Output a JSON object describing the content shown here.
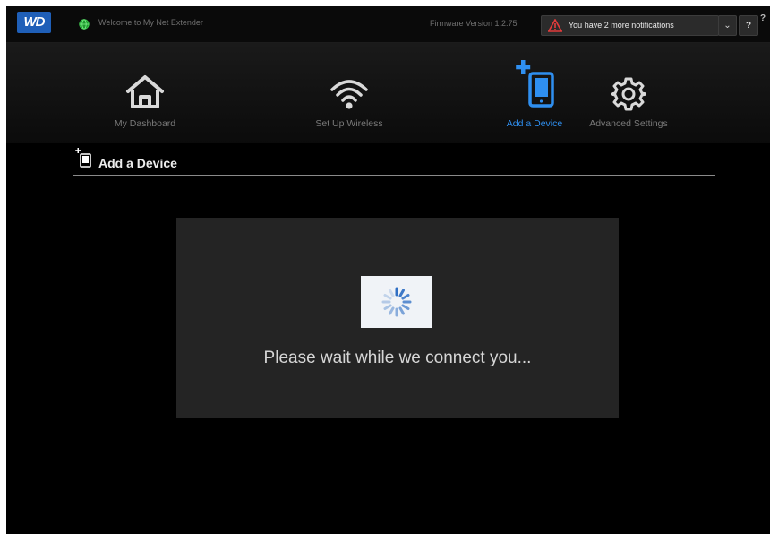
{
  "brand": {
    "logo_text": "WD"
  },
  "topbar": {
    "welcome_text": "Welcome to My Net Extender",
    "firmware_text": "Firmware Version 1.2.75",
    "notification_text": "You have 2 more notifications",
    "help_label": "?"
  },
  "nav": {
    "items": [
      {
        "label": "My Dashboard",
        "icon": "home-icon",
        "active": false
      },
      {
        "label": "Set Up Wireless",
        "icon": "wifi-icon",
        "active": false
      },
      {
        "label": "Add a Device",
        "icon": "add-device-icon",
        "active": true
      },
      {
        "label": "Advanced Settings",
        "icon": "gear-icon",
        "active": false
      }
    ]
  },
  "page": {
    "title": "Add a Device"
  },
  "status": {
    "message": "Please wait while we connect you...",
    "icon": "spinner-icon"
  },
  "colors": {
    "background": "#000000",
    "accent": "#2f8ff0",
    "brand_blue": "#1f5fb8",
    "warning": "#e23b3b",
    "panel": "#242424"
  }
}
